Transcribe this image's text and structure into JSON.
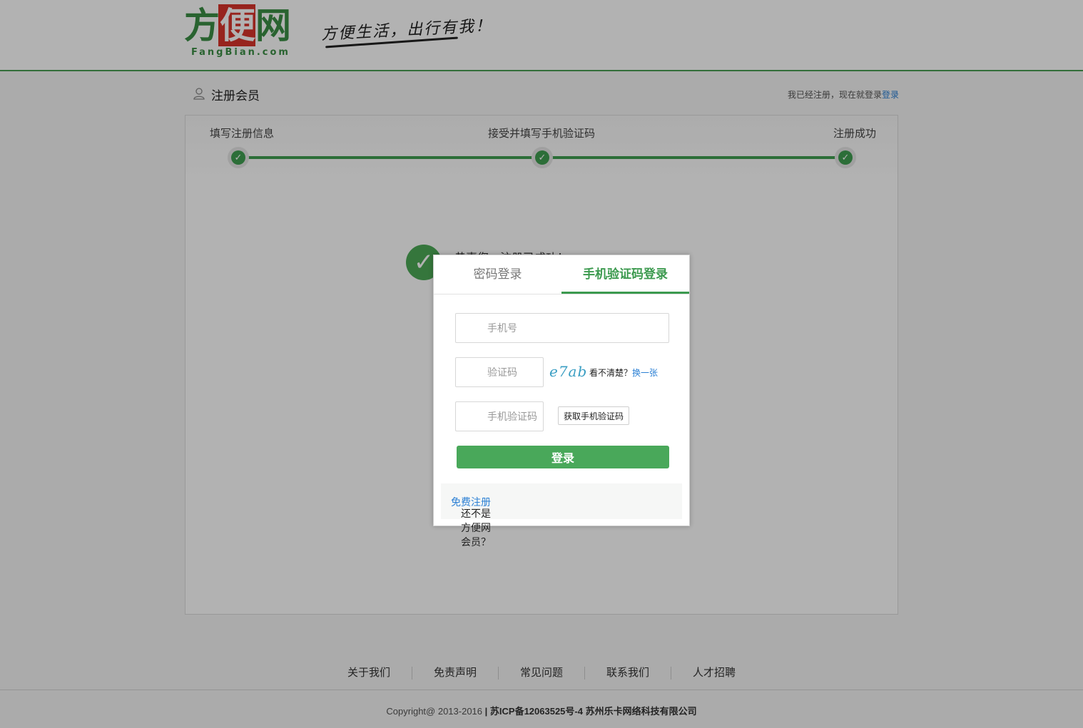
{
  "header": {
    "logo_main_left": "方",
    "logo_main_mid": "便",
    "logo_main_right": "网",
    "logo_sub": "FangBian.com",
    "slogan": "方便生活，出行有我！"
  },
  "title_row": {
    "title": "注册会员",
    "login_hint_prefix": "我已经注册，现在就登录",
    "login_hint_link": "登录"
  },
  "steps": [
    {
      "label": "填写注册信息"
    },
    {
      "label": "接受并填写手机验证码"
    },
    {
      "label": "注册成功"
    }
  ],
  "success": {
    "text": "恭喜您，注册已成功！"
  },
  "modal": {
    "tab_password": "密码登录",
    "tab_sms": "手机验证码登录",
    "active_tab": "tab_sms",
    "phone_placeholder": "手机号",
    "captcha_placeholder": "验证码",
    "captcha_text": "e7ab",
    "captcha_hint": "看不清楚？",
    "captcha_refresh": "换一张",
    "sms_placeholder": "手机验证码",
    "sms_button": "获取手机验证码",
    "login_button": "登录",
    "footer_prefix": "还不是方便网会员？",
    "footer_link": "免费注册"
  },
  "footer": {
    "links": [
      "关于我们",
      "免责声明",
      "常见问题",
      "联系我们",
      "人才招聘"
    ],
    "copyright_prefix": "Copyright@ 2013-2016",
    "copyright_rest": "| 苏ICP备12063525号-4 苏州乐卡网络科技有限公司"
  },
  "colors": {
    "brand_green": "#3c9a4f",
    "brand_red": "#d9342b",
    "link_blue": "#2a7fd4"
  }
}
